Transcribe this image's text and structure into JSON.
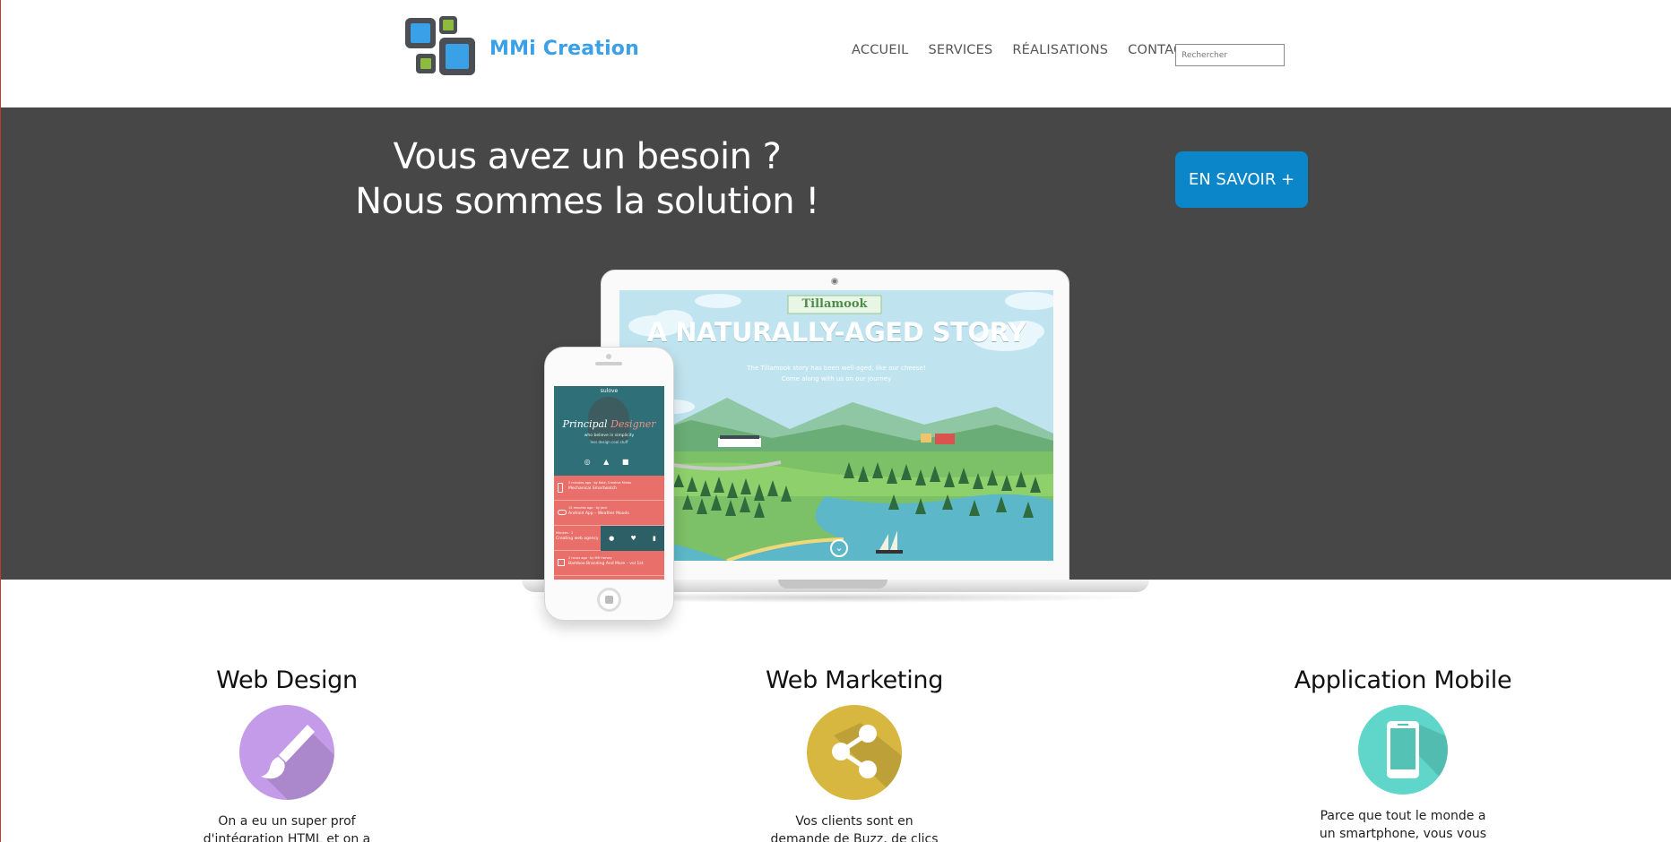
{
  "brand": {
    "name": "MMi Creation",
    "accent_color": "#3aa0e8",
    "logo_icon": "squares-logo-icon"
  },
  "nav": {
    "items": [
      {
        "label": "ACCUEIL"
      },
      {
        "label": "SERVICES"
      },
      {
        "label": "RÉALISATIONS"
      },
      {
        "label": "CONTACT"
      }
    ],
    "search_placeholder": "Rechercher"
  },
  "hero": {
    "title_line1": "Vous avez un besoin ?",
    "title_line2": "Nous sommes la solution !",
    "cta_label": "EN SAVOIR +",
    "background_color": "#474747",
    "cta_color": "#0a86c9"
  },
  "laptop_screen": {
    "brand": "Tillamook",
    "headline": "A NATURALLY-AGED STORY",
    "sub_line1": "The Tillamook story has been well-aged, like our cheese!",
    "sub_line2": "Come along with us on our journey",
    "scroll_icon": "chevron-down-circle-icon"
  },
  "phone_screen": {
    "app_name": "sulove",
    "headline_a": "Principal",
    "headline_b": "Designer",
    "tagline": "who believe in simplicity",
    "tagline2": "less design cool stuff",
    "rows": [
      {
        "meta": "2 minutes ago · by Kate, Creative Minds",
        "text": "Mechanical Smartwatch"
      },
      {
        "meta": "15 minutes ago · by Jack",
        "text": "Android App – Weather Moods"
      },
      {
        "meta": "Minutes · 2",
        "text": "Creating web agency"
      },
      {
        "meta": "2 hours ago · by MR Harvey",
        "text": "Bamboo Branding And More – vol 1st"
      }
    ]
  },
  "services": [
    {
      "title": "Web Design",
      "text": "On a eu un super prof d'intégration HTML et on a de",
      "color": "#c39be8",
      "icon": "paintbrush-icon"
    },
    {
      "title": "Web Marketing",
      "text": "Vos clients sont en demande de Buzz, de clics de vues de fans ?",
      "color": "#d8b740",
      "icon": "share-icon"
    },
    {
      "title": "Application Mobile",
      "text": "Parce que tout le monde a un smartphone, vous vous devez",
      "color": "#5fd6c9",
      "icon": "smartphone-icon"
    }
  ]
}
